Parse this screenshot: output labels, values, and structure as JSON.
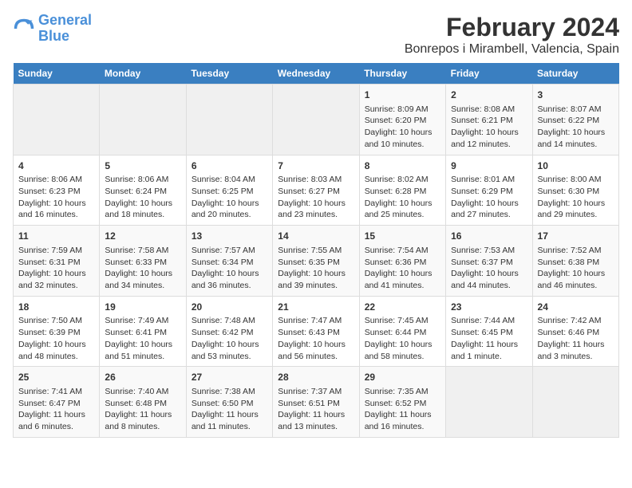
{
  "logo": {
    "line1": "General",
    "line2": "Blue"
  },
  "title": "February 2024",
  "subtitle": "Bonrepos i Mirambell, Valencia, Spain",
  "weekdays": [
    "Sunday",
    "Monday",
    "Tuesday",
    "Wednesday",
    "Thursday",
    "Friday",
    "Saturday"
  ],
  "weeks": [
    [
      {
        "day": "",
        "info": ""
      },
      {
        "day": "",
        "info": ""
      },
      {
        "day": "",
        "info": ""
      },
      {
        "day": "",
        "info": ""
      },
      {
        "day": "1",
        "info": "Sunrise: 8:09 AM\nSunset: 6:20 PM\nDaylight: 10 hours\nand 10 minutes."
      },
      {
        "day": "2",
        "info": "Sunrise: 8:08 AM\nSunset: 6:21 PM\nDaylight: 10 hours\nand 12 minutes."
      },
      {
        "day": "3",
        "info": "Sunrise: 8:07 AM\nSunset: 6:22 PM\nDaylight: 10 hours\nand 14 minutes."
      }
    ],
    [
      {
        "day": "4",
        "info": "Sunrise: 8:06 AM\nSunset: 6:23 PM\nDaylight: 10 hours\nand 16 minutes."
      },
      {
        "day": "5",
        "info": "Sunrise: 8:06 AM\nSunset: 6:24 PM\nDaylight: 10 hours\nand 18 minutes."
      },
      {
        "day": "6",
        "info": "Sunrise: 8:04 AM\nSunset: 6:25 PM\nDaylight: 10 hours\nand 20 minutes."
      },
      {
        "day": "7",
        "info": "Sunrise: 8:03 AM\nSunset: 6:27 PM\nDaylight: 10 hours\nand 23 minutes."
      },
      {
        "day": "8",
        "info": "Sunrise: 8:02 AM\nSunset: 6:28 PM\nDaylight: 10 hours\nand 25 minutes."
      },
      {
        "day": "9",
        "info": "Sunrise: 8:01 AM\nSunset: 6:29 PM\nDaylight: 10 hours\nand 27 minutes."
      },
      {
        "day": "10",
        "info": "Sunrise: 8:00 AM\nSunset: 6:30 PM\nDaylight: 10 hours\nand 29 minutes."
      }
    ],
    [
      {
        "day": "11",
        "info": "Sunrise: 7:59 AM\nSunset: 6:31 PM\nDaylight: 10 hours\nand 32 minutes."
      },
      {
        "day": "12",
        "info": "Sunrise: 7:58 AM\nSunset: 6:33 PM\nDaylight: 10 hours\nand 34 minutes."
      },
      {
        "day": "13",
        "info": "Sunrise: 7:57 AM\nSunset: 6:34 PM\nDaylight: 10 hours\nand 36 minutes."
      },
      {
        "day": "14",
        "info": "Sunrise: 7:55 AM\nSunset: 6:35 PM\nDaylight: 10 hours\nand 39 minutes."
      },
      {
        "day": "15",
        "info": "Sunrise: 7:54 AM\nSunset: 6:36 PM\nDaylight: 10 hours\nand 41 minutes."
      },
      {
        "day": "16",
        "info": "Sunrise: 7:53 AM\nSunset: 6:37 PM\nDaylight: 10 hours\nand 44 minutes."
      },
      {
        "day": "17",
        "info": "Sunrise: 7:52 AM\nSunset: 6:38 PM\nDaylight: 10 hours\nand 46 minutes."
      }
    ],
    [
      {
        "day": "18",
        "info": "Sunrise: 7:50 AM\nSunset: 6:39 PM\nDaylight: 10 hours\nand 48 minutes."
      },
      {
        "day": "19",
        "info": "Sunrise: 7:49 AM\nSunset: 6:41 PM\nDaylight: 10 hours\nand 51 minutes."
      },
      {
        "day": "20",
        "info": "Sunrise: 7:48 AM\nSunset: 6:42 PM\nDaylight: 10 hours\nand 53 minutes."
      },
      {
        "day": "21",
        "info": "Sunrise: 7:47 AM\nSunset: 6:43 PM\nDaylight: 10 hours\nand 56 minutes."
      },
      {
        "day": "22",
        "info": "Sunrise: 7:45 AM\nSunset: 6:44 PM\nDaylight: 10 hours\nand 58 minutes."
      },
      {
        "day": "23",
        "info": "Sunrise: 7:44 AM\nSunset: 6:45 PM\nDaylight: 11 hours\nand 1 minute."
      },
      {
        "day": "24",
        "info": "Sunrise: 7:42 AM\nSunset: 6:46 PM\nDaylight: 11 hours\nand 3 minutes."
      }
    ],
    [
      {
        "day": "25",
        "info": "Sunrise: 7:41 AM\nSunset: 6:47 PM\nDaylight: 11 hours\nand 6 minutes."
      },
      {
        "day": "26",
        "info": "Sunrise: 7:40 AM\nSunset: 6:48 PM\nDaylight: 11 hours\nand 8 minutes."
      },
      {
        "day": "27",
        "info": "Sunrise: 7:38 AM\nSunset: 6:50 PM\nDaylight: 11 hours\nand 11 minutes."
      },
      {
        "day": "28",
        "info": "Sunrise: 7:37 AM\nSunset: 6:51 PM\nDaylight: 11 hours\nand 13 minutes."
      },
      {
        "day": "29",
        "info": "Sunrise: 7:35 AM\nSunset: 6:52 PM\nDaylight: 11 hours\nand 16 minutes."
      },
      {
        "day": "",
        "info": ""
      },
      {
        "day": "",
        "info": ""
      }
    ]
  ]
}
